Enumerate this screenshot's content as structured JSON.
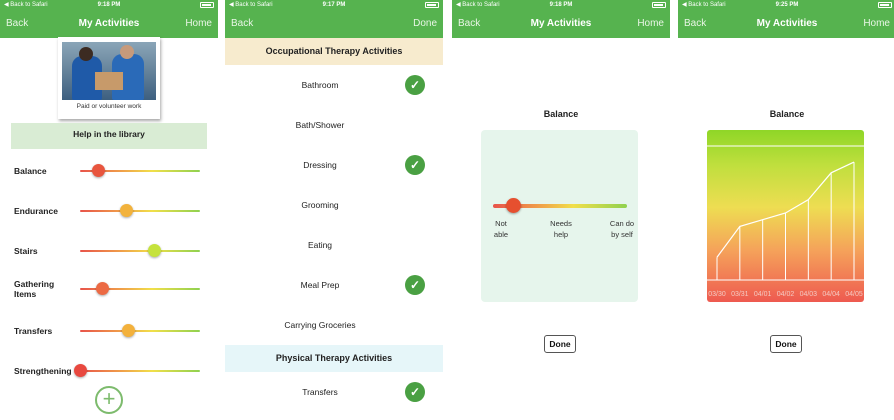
{
  "statusbar": {
    "back_to_app": "◀ Back to Safari",
    "screens": [
      {
        "time": "9:18 PM"
      },
      {
        "time": "9:17 PM"
      },
      {
        "time": "9:18 PM"
      },
      {
        "time": "9:25 PM"
      }
    ]
  },
  "screen1": {
    "nav": {
      "back": "Back",
      "title": "My Activities",
      "right": "Home"
    },
    "activity_category": "Paid or volunteer work",
    "task_title": "Help in the library",
    "activities": [
      {
        "label": "Balance",
        "level": 0.15,
        "color": "#e8553e"
      },
      {
        "label": "Endurance",
        "level": 0.38,
        "color": "#f2b23c"
      },
      {
        "label": "Stairs",
        "level": 0.62,
        "color": "#c5e23c"
      },
      {
        "label": "Gathering Items",
        "level": 0.18,
        "color": "#ec6a44"
      },
      {
        "label": "Transfers",
        "level": 0.4,
        "color": "#f3b13c"
      },
      {
        "label": "Strengthening",
        "level": 0.0,
        "color": "#e8483f"
      }
    ],
    "add_icon": "plus-circle-icon",
    "add_glyph": "+"
  },
  "screen2": {
    "nav": {
      "back": "Back",
      "title": "",
      "right": "Done"
    },
    "ot_header": "Occupational Therapy Activities",
    "ot_items": [
      {
        "label": "Bathroom",
        "checked": true
      },
      {
        "label": "Bath/Shower",
        "checked": false
      },
      {
        "label": "Dressing",
        "checked": true
      },
      {
        "label": "Grooming",
        "checked": false
      },
      {
        "label": "Eating",
        "checked": false
      },
      {
        "label": "Meal Prep",
        "checked": true
      },
      {
        "label": "Carrying Groceries",
        "checked": false
      }
    ],
    "pt_header": "Physical Therapy Activities",
    "pt_items": [
      {
        "label": "Transfers",
        "checked": true
      }
    ],
    "check_glyph": "✓",
    "check_color": "#4aa043"
  },
  "screen3": {
    "nav": {
      "back": "Back",
      "title": "My Activities",
      "right": "Home"
    },
    "metric": "Balance",
    "level": 0.15,
    "scale_labels": [
      "Not\nable",
      "Needs\nhelp",
      "Can do\nby self"
    ],
    "done": "Done"
  },
  "screen4": {
    "nav": {
      "back": "Back",
      "title": "My Activities",
      "right": "Home"
    },
    "metric": "Balance",
    "done": "Done",
    "chart_data": {
      "type": "area",
      "title": "Balance",
      "x": [
        "03/30",
        "03/31",
        "04/01",
        "04/02",
        "04/03",
        "04/04",
        "04/05"
      ],
      "y": [
        0.17,
        0.4,
        0.45,
        0.5,
        0.6,
        0.8,
        0.88
      ],
      "ylim": [
        0,
        1
      ],
      "grid": false,
      "gradient_colors": [
        "#8fd627",
        "#eedd52",
        "#ee5a50"
      ]
    }
  },
  "accent": "#56b34f"
}
